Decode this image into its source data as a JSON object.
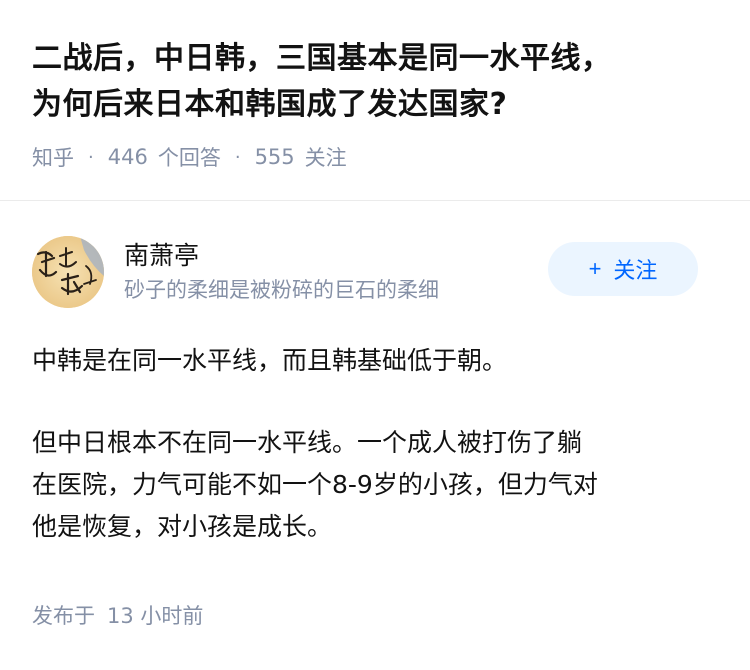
{
  "question": {
    "title_line1": "二战后，中日韩，三国基本是同一水平线，",
    "title_line2": "为何后来日本和韩国成了发达国家?",
    "source": "知乎",
    "answers_count": "446",
    "answers_label": "个回答",
    "followers_count": "555",
    "followers_label": "关注"
  },
  "author": {
    "name": "南萧亭",
    "bio": "砂子的柔细是被粉碎的巨石的柔细",
    "follow_label": "关注",
    "follow_icon": "+"
  },
  "answer": {
    "paragraph1": "中韩是在同一水平线，而且韩基础低于朝。",
    "paragraph2_line1": "但中日根本不在同一水平线。一个成人被打伤了躺",
    "paragraph2_line2": "在医院，力气可能不如一个8-9岁的小孩，但力气对",
    "paragraph2_line3": "他是恢复，对小孩是成长。"
  },
  "published": {
    "label": "发布于",
    "time": "13 小时前"
  },
  "colors": {
    "meta_gray": "#8590a6",
    "follow_blue": "#0066ff",
    "follow_bg": "#ebf5ff"
  }
}
